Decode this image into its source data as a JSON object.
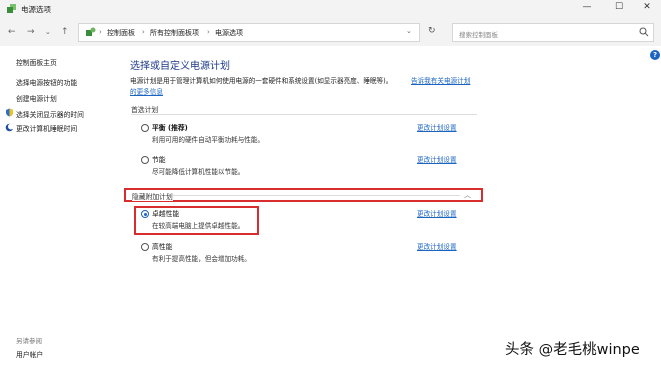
{
  "window": {
    "title": "电源选项",
    "controls": {
      "minimize": "—",
      "maximize": "☐",
      "close": "✕"
    }
  },
  "nav": {
    "back": "←",
    "forward": "→",
    "recent": "⌄",
    "up": "↑",
    "breadcrumbs": [
      "控制面板",
      "所有控制面板项",
      "电源选项"
    ],
    "separator": "›",
    "dropdown": "⌄",
    "refresh": "↻",
    "search_placeholder": "搜索控制面板"
  },
  "sidebar": {
    "home": "控制面板主页",
    "items": [
      "选择电源按钮的功能",
      "创建电源计划",
      "选择关闭显示器的时间",
      "更改计算机睡眠时间"
    ],
    "see_also": "另请参阅",
    "see_also_items": [
      "用户帐户"
    ]
  },
  "main": {
    "help": "?",
    "title": "选择或自定义电源计划",
    "description": "电源计划是用于管理计算机如何使用电源的一套硬件和系统设置(如显示器亮度、睡眠等)。",
    "desc_link_part1": "告诉我有关电源计划",
    "desc_link_part2": "的更多信息",
    "preferred_label": "首选计划",
    "hidden_label": "隐藏附加计划",
    "hidden_chevron": "︿",
    "change_link": "更改计划设置",
    "plans": [
      {
        "name": "平衡 (推荐)",
        "desc": "利用可用的硬件自动平衡功耗与性能。",
        "checked": false
      },
      {
        "name": "节能",
        "desc": "尽可能降低计算机性能以节能。",
        "checked": false
      },
      {
        "name": "卓越性能",
        "desc": "在较高端电脑上提供卓越性能。",
        "checked": true
      },
      {
        "name": "高性能",
        "desc": "有利于提高性能，但会增加功耗。",
        "checked": false
      }
    ]
  },
  "watermark": "头条 @老毛桃winpe",
  "colors": {
    "link": "#1b64c2",
    "highlight": "#d92c2c",
    "title": "#1e3a8a"
  }
}
